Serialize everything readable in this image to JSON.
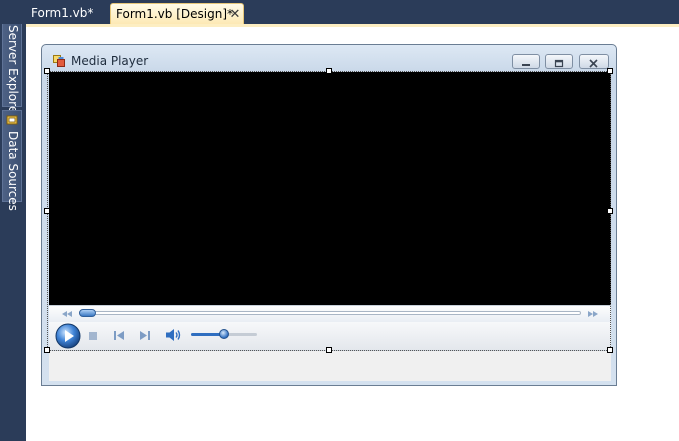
{
  "ide": {
    "tabs": [
      {
        "label": "Form1.vb*",
        "active": false
      },
      {
        "label": "Form1.vb [Design]*",
        "active": true
      }
    ],
    "tab_close_glyph": "✕",
    "side_tabs": [
      {
        "label": "Server Explorer",
        "icon": "server-explorer-icon"
      },
      {
        "label": "Data Sources",
        "icon": "data-sources-icon"
      }
    ],
    "colors": {
      "chrome": "#2b3c59",
      "active_tab": "#fde9b4",
      "surface": "#ffffff"
    }
  },
  "form": {
    "title": "Media Player",
    "icon": "form-icon",
    "caption_buttons": [
      "minimize-icon",
      "maximize-icon",
      "close-icon"
    ]
  },
  "media_player": {
    "video_background": "#000000",
    "seek_position": 0.0,
    "volume_level": 0.5,
    "buttons": [
      "play-icon",
      "stop-icon",
      "previous-icon",
      "next-icon",
      "speaker-icon"
    ],
    "seek_arrows": [
      "rewind-icon",
      "fast-forward-icon"
    ]
  }
}
